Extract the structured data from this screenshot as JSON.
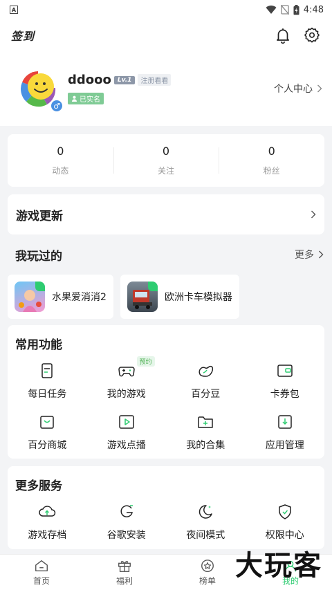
{
  "status": {
    "time": "4:48",
    "notif_icon": "A"
  },
  "header": {
    "signin": "签到"
  },
  "profile": {
    "username": "ddooo",
    "level": "Lv.1",
    "reg_tag": "注册看看",
    "verified": "已实名",
    "personal_center": "个人中心",
    "gender_symbol": "♂"
  },
  "stats": [
    {
      "value": "0",
      "label": "动态"
    },
    {
      "value": "0",
      "label": "关注"
    },
    {
      "value": "0",
      "label": "粉丝"
    }
  ],
  "game_update": {
    "title": "游戏更新"
  },
  "played": {
    "title": "我玩过的",
    "more": "更多",
    "games": [
      {
        "name": "水果爱消消2"
      },
      {
        "name": "欧洲卡车模拟器"
      }
    ]
  },
  "functions": {
    "title": "常用功能",
    "items": [
      {
        "label": "每日任务"
      },
      {
        "label": "我的游戏",
        "badge": "预约"
      },
      {
        "label": "百分豆"
      },
      {
        "label": "卡券包"
      },
      {
        "label": "百分商城"
      },
      {
        "label": "游戏点播"
      },
      {
        "label": "我的合集"
      },
      {
        "label": "应用管理"
      }
    ]
  },
  "services": {
    "title": "更多服务",
    "items": [
      {
        "label": "游戏存档"
      },
      {
        "label": "谷歌安装"
      },
      {
        "label": "夜间模式"
      },
      {
        "label": "权限中心"
      }
    ]
  },
  "tabs": [
    {
      "label": "首页"
    },
    {
      "label": "福利"
    },
    {
      "label": "榜单"
    },
    {
      "label": "我的"
    }
  ],
  "watermark": "大玩客",
  "colors": {
    "accent": "#2ecc71",
    "verified": "#7fcb95",
    "level": "#8d97a8"
  }
}
